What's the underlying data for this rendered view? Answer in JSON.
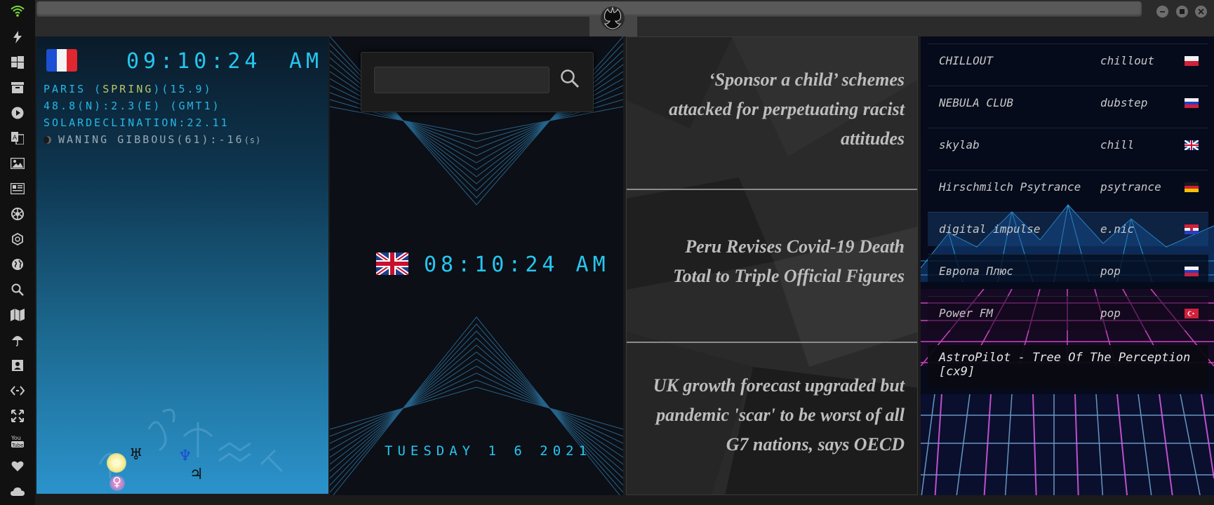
{
  "colors": {
    "lcd": "#26c6f0",
    "paris_text": "#26b7e6",
    "spring": "#b8c86a",
    "news_text": "#bdbdbd"
  },
  "sidebar": {
    "icons": [
      "wifi-icon",
      "lightning-icon",
      "windows-icon",
      "archive-icon",
      "play-icon",
      "translate-icon",
      "image-icon",
      "news-icon",
      "aperture-icon",
      "hexagon-icon",
      "globe-icon",
      "search-icon",
      "map-icon",
      "umbrella-icon",
      "contact-icon",
      "code-icon",
      "expand-icon",
      "youtube-icon",
      "heart-icon",
      "cloud-icon"
    ]
  },
  "window_controls": [
    "minimize",
    "maximize",
    "close"
  ],
  "paris": {
    "country_flag": "France",
    "time": "09:10:24",
    "ampm": "AM",
    "line1_prefix": "PARIS (",
    "season": "SPRING",
    "line1_suffix": ")(15.9)",
    "line2": "48.8(N):2.3(E) (GMT1)",
    "line3": "SOLARDECLINATION:22.11",
    "moon": "WANING GIBBOUS(61):-16",
    "moon_unit": "(s)",
    "planets": {
      "uranus": "♅",
      "neptune": "♆",
      "jupiter": "♃",
      "venus": "♀"
    }
  },
  "clock": {
    "search_placeholder": "",
    "time": "08:10:24 AM",
    "date": "TUESDAY 1 6 2021"
  },
  "news": [
    "‘Sponsor a child’ schemes attacked for perpetuating racist attitudes",
    "Peru Revises Covid-19 Death Total to Triple Official Figures",
    "UK growth forecast upgraded but pandemic 'scar' to be worst of all G7 nations, says OECD"
  ],
  "radio": {
    "stations": [
      {
        "name": "CHILLOUT",
        "genre": "chillout",
        "flag": "poland"
      },
      {
        "name": "NEBULA CLUB",
        "genre": "dubstep",
        "flag": "russia"
      },
      {
        "name": "skylab",
        "genre": "chill",
        "flag": "uk"
      },
      {
        "name": "Hirschmilch Psytrance",
        "genre": "psytrance",
        "flag": "germany"
      },
      {
        "name": "digital impulse",
        "genre": "e.nic",
        "flag": "croatia"
      },
      {
        "name": "Европа Плюс",
        "genre": "pop",
        "flag": "russia"
      },
      {
        "name": "Power FM",
        "genre": "pop",
        "flag": "turkey"
      }
    ],
    "now_playing": "AstroPilot - Tree Of The Perception [cx9]"
  }
}
